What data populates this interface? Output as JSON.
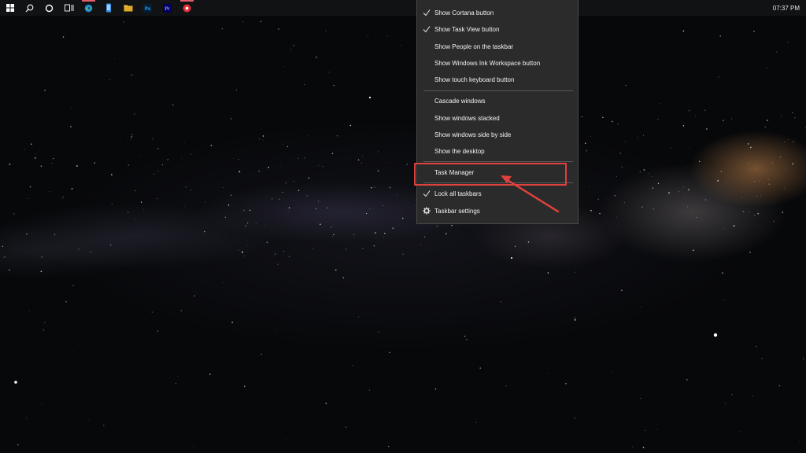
{
  "taskbar": {
    "icons": [
      {
        "name": "windows-start-icon",
        "color": "#ffffff"
      },
      {
        "name": "search-icon",
        "color": "#ffffff"
      },
      {
        "name": "cortana-icon",
        "color": "#ffffff"
      },
      {
        "name": "task-view-icon",
        "color": "#ffffff"
      },
      {
        "name": "edge-icon",
        "color": "#2fa3e0"
      },
      {
        "name": "phone-icon",
        "color": "#3d8ee6"
      },
      {
        "name": "file-explorer-icon",
        "color": "#f2c744"
      },
      {
        "name": "photoshop-icon",
        "color": "#31a8ff",
        "text": "Ps"
      },
      {
        "name": "premiere-icon",
        "color": "#9999ff",
        "text": "Pr"
      },
      {
        "name": "record-app-icon",
        "color": "#e0303a"
      }
    ],
    "clock": "07:37 PM"
  },
  "menu": {
    "group1": [
      {
        "label": "Show Cortana button",
        "checked": true
      },
      {
        "label": "Show Task View button",
        "checked": true
      },
      {
        "label": "Show People on the taskbar",
        "checked": false
      },
      {
        "label": "Show Windows Ink Workspace button",
        "checked": false
      },
      {
        "label": "Show touch keyboard button",
        "checked": false
      }
    ],
    "group2": [
      {
        "label": "Cascade windows"
      },
      {
        "label": "Show windows stacked"
      },
      {
        "label": "Show windows side by side"
      },
      {
        "label": "Show the desktop"
      }
    ],
    "task_manager": "Task Manager",
    "lock_taskbars": "Lock all taskbars",
    "taskbar_settings": "Taskbar settings"
  },
  "annotation_color": "#e0413d"
}
